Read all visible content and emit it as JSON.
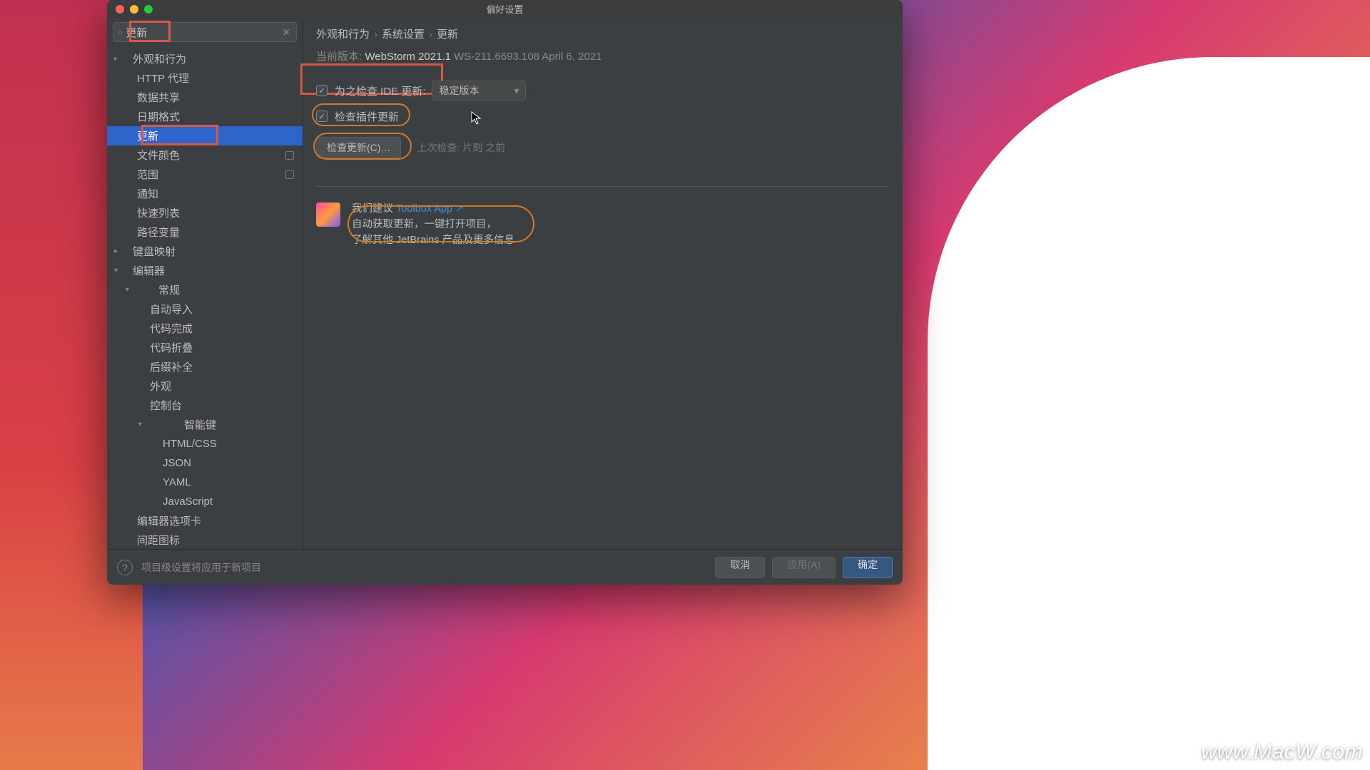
{
  "window_title": "偏好设置",
  "search": {
    "value": "更新"
  },
  "sidebar": [
    {
      "label": "外观和行为",
      "depth": 0,
      "exp": false
    },
    {
      "label": "HTTP 代理",
      "depth": 1
    },
    {
      "label": "数据共享",
      "depth": 1
    },
    {
      "label": "日期格式",
      "depth": 1
    },
    {
      "label": "更新",
      "depth": 1,
      "sel": true,
      "hl": true
    },
    {
      "label": "文件颜色",
      "depth": 1,
      "badge": true
    },
    {
      "label": "范围",
      "depth": 1,
      "badge": true
    },
    {
      "label": "通知",
      "depth": 1
    },
    {
      "label": "快速列表",
      "depth": 1
    },
    {
      "label": "路径变量",
      "depth": 1
    },
    {
      "label": "键盘映射",
      "depth": 0
    },
    {
      "label": "编辑器",
      "depth": 0,
      "exp": true
    },
    {
      "label": "常规",
      "depth": 1,
      "exp": true,
      "chev": true
    },
    {
      "label": "自动导入",
      "depth": 2
    },
    {
      "label": "代码完成",
      "depth": 2
    },
    {
      "label": "代码折叠",
      "depth": 2
    },
    {
      "label": "后缀补全",
      "depth": 2
    },
    {
      "label": "外观",
      "depth": 2
    },
    {
      "label": "控制台",
      "depth": 2
    },
    {
      "label": "智能键",
      "depth": 2,
      "exp": true,
      "chev": true
    },
    {
      "label": "HTML/CSS",
      "depth": 3
    },
    {
      "label": "JSON",
      "depth": 3
    },
    {
      "label": "YAML",
      "depth": 3
    },
    {
      "label": "JavaScript",
      "depth": 3
    },
    {
      "label": "编辑器选项卡",
      "depth": 1
    },
    {
      "label": "间距图标",
      "depth": 1
    }
  ],
  "breadcrumb": [
    "外观和行为",
    "系统设置",
    "更新"
  ],
  "version": {
    "prefix": "当前版本:",
    "name": "WebStorm 2021.1",
    "build": "WS-211.6693.108 April 6, 2021"
  },
  "check_ide": {
    "label": "为之检查 IDE 更新:",
    "channel": "稳定版本"
  },
  "check_plugins": {
    "label": "检查插件更新"
  },
  "check_now_btn": "检查更新(C)…",
  "last_check": "上次检查: 片刻 之前",
  "promo": {
    "prefix": "我们建议 ",
    "link": "Toolbox App ↗",
    "line1": "自动获取更新，一键打开项目，",
    "line2": "了解其他 JetBrains 产品及更多信息"
  },
  "footer_note": "项目级设置将应用于新项目",
  "buttons": {
    "cancel": "取消",
    "apply": "应用(A)",
    "ok": "确定"
  },
  "watermark": "www.MacW.com"
}
